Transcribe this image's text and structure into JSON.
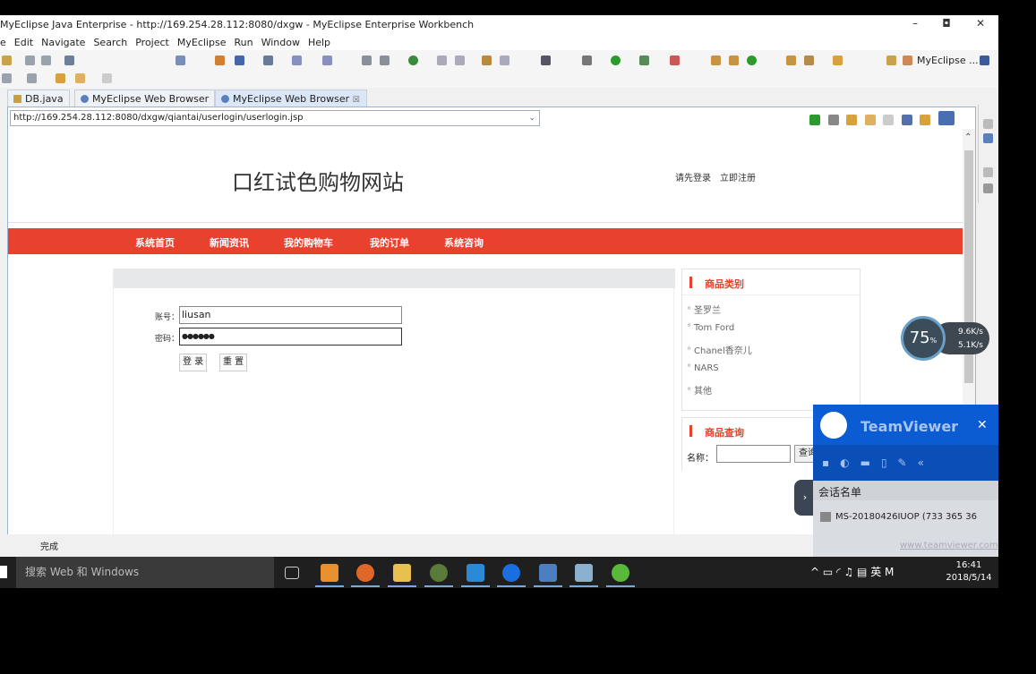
{
  "window": {
    "title": "MyEclipse Java Enterprise - http://169.254.28.112:8080/dxgw - MyEclipse Enterprise Workbench",
    "minimize": "–",
    "maximize": "◘",
    "close": "✕"
  },
  "menu": [
    "e",
    "Edit",
    "Navigate",
    "Search",
    "Project",
    "MyEclipse",
    "Run",
    "Window",
    "Help"
  ],
  "perspective": "MyEclipse ...",
  "tabs": [
    {
      "label": "DB.java"
    },
    {
      "label": "MyEclipse Web Browser"
    },
    {
      "label": "MyEclipse Web Browser",
      "close": "☒"
    }
  ],
  "browser": {
    "url": "http://169.254.28.112:8080/dxgw/qiantai/userlogin/userlogin.jsp"
  },
  "site": {
    "title": "口红试色购物网站",
    "links": [
      "请先登录",
      "立即注册"
    ],
    "nav": [
      "系统首页",
      "新闻资讯",
      "我的购物车",
      "我的订单",
      "系统咨询"
    ]
  },
  "login": {
    "account_label": "账号：",
    "account_value": "liusan",
    "password_label": "密码：",
    "password_value": "●●●●●●",
    "login_button": "登 录",
    "reset_button": "重 置"
  },
  "categories": {
    "title": "商品类别",
    "items": [
      "圣罗兰",
      "Tom Ford",
      "Chanel香奈儿",
      "NARS",
      "其他"
    ]
  },
  "query": {
    "title": "商品查询",
    "name_label": "名称：",
    "button": "查询"
  },
  "status": "完成",
  "net": {
    "percent": "75",
    "unit": "%",
    "up": "9.6K/s",
    "down": "5.1K/s"
  },
  "teamviewer": {
    "name": "TeamViewer",
    "close": "✕",
    "section": "会话名单",
    "entry": "MS-20180426IUOP (733 365 36",
    "footer": "www.teamviewer.com"
  },
  "taskbar": {
    "search_placeholder": "搜索 Web 和 Windows",
    "tray": "^ ▭ ◜ ♫ ▤ 英 M",
    "time": "16:41",
    "date": "2018/5/14"
  },
  "colors": {
    "nav_red": "#e8412e",
    "teamviewer_blue": "#0a4fb7"
  }
}
